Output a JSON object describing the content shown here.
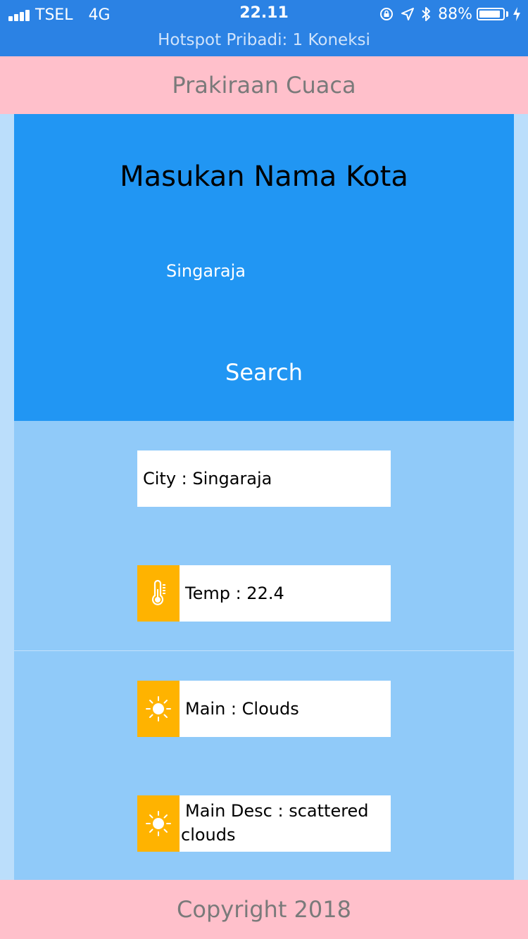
{
  "status_bar": {
    "carrier": "TSEL",
    "network": "4G",
    "time": "22.11",
    "battery_percent": "88%",
    "hotspot": "Hotspot Pribadi: 1 Koneksi"
  },
  "header": {
    "title": "Prakiraan Cuaca"
  },
  "search": {
    "title": "Masukan Nama Kota",
    "input_value": "Singaraja",
    "button_label": "Search"
  },
  "results": {
    "city": "City : Singaraja",
    "temp": "Temp : 22.4",
    "main": "Main : Clouds",
    "main_desc": "Main Desc : scattered clouds"
  },
  "icons": {
    "temp": "thermometer-icon",
    "main": "sun-icon",
    "desc": "sun-icon"
  },
  "colors": {
    "status_bar": "#2b82e4",
    "header_footer": "#ffc0cb",
    "search_panel": "#2196f3",
    "results_bg": "#90caf9",
    "icon_bg": "#ffb300"
  },
  "footer": {
    "text": "Copyright 2018"
  }
}
